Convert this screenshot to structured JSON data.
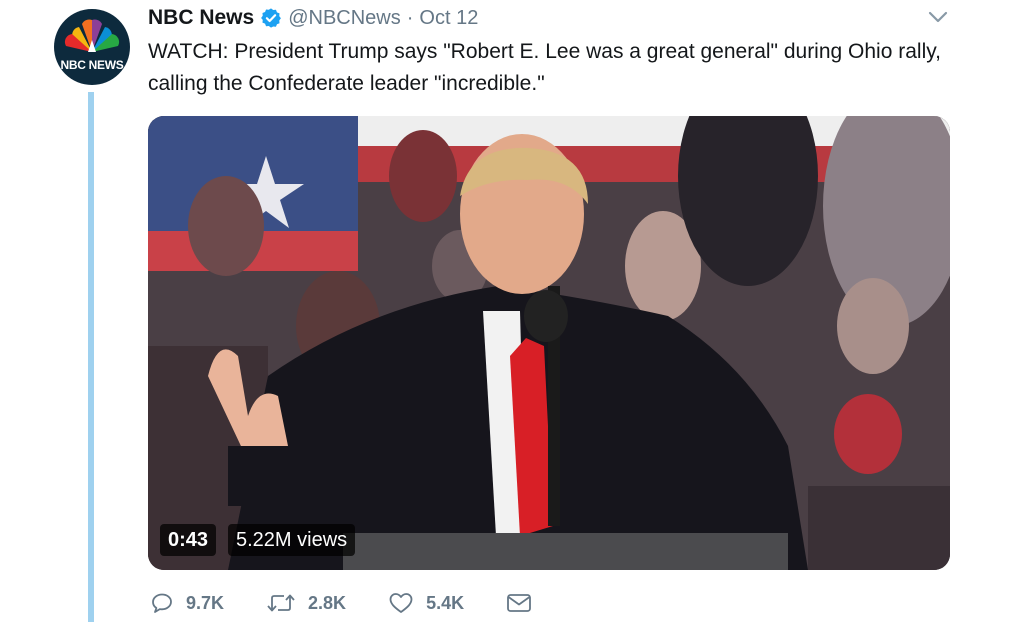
{
  "account": {
    "avatar_text": "NBC NEWS",
    "name": "NBC News",
    "handle": "@NBCNews",
    "separator": "·",
    "date": "Oct 12"
  },
  "tweet": {
    "text": "WATCH: President Trump says \"Robert E. Lee was a great general\" during Ohio rally, calling the Confederate leader \"incredible.\""
  },
  "video": {
    "duration": "0:43",
    "views": "5.22M views"
  },
  "actions": {
    "reply_count": "9.7K",
    "retweet_count": "2.8K",
    "like_count": "5.4K"
  },
  "icons": {
    "verified": "verified-badge-icon",
    "menu": "chevron-down-icon",
    "reply": "reply-icon",
    "retweet": "retweet-icon",
    "like": "heart-icon",
    "dm": "envelope-icon"
  },
  "colors": {
    "verified_blue": "#1da1f2",
    "thread_line": "#9fd1ef",
    "secondary_text": "#657786",
    "primary_text": "#14171a"
  }
}
